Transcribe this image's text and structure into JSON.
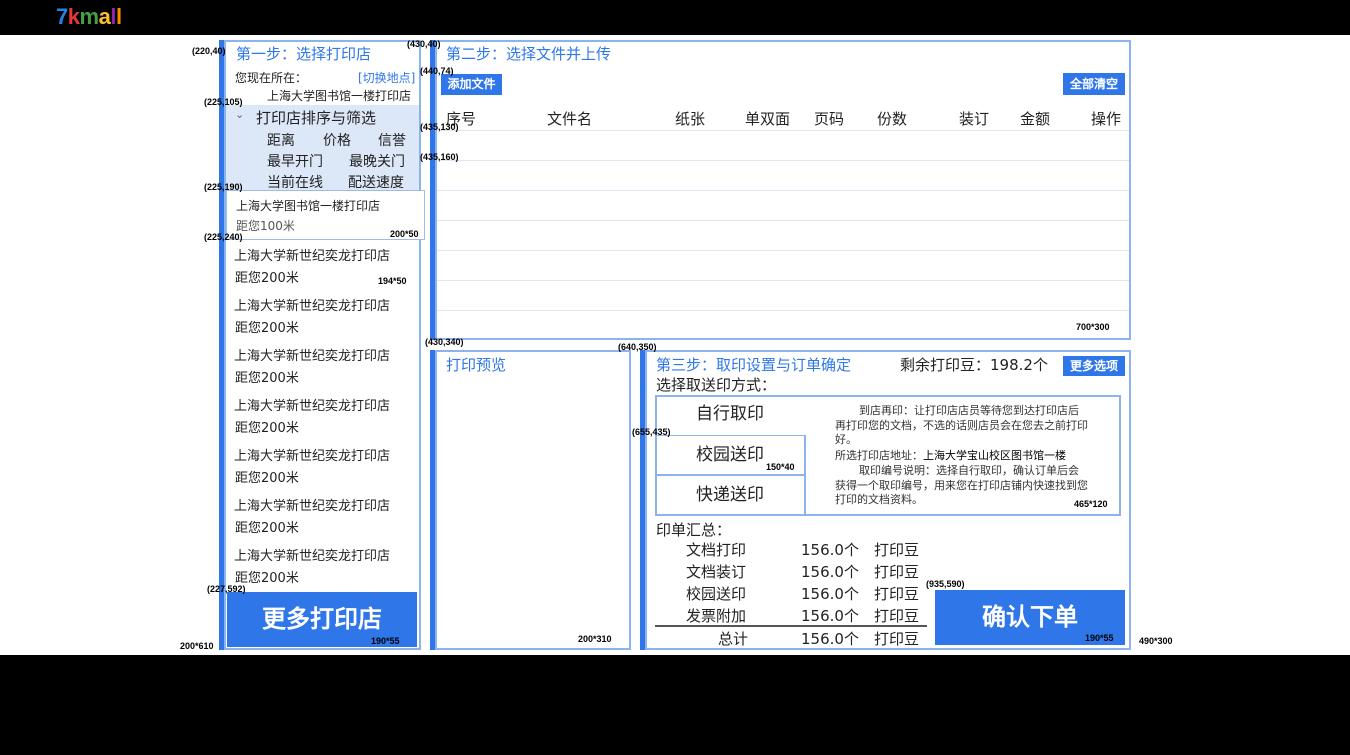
{
  "logo": {
    "parts": [
      {
        "t": "7",
        "c": "#1e88e5"
      },
      {
        "t": "k",
        "c": "#e53935"
      },
      {
        "t": "m",
        "c": "#43a047"
      },
      {
        "t": "a",
        "c": "#fbc02d"
      },
      {
        "t": "l",
        "c": "#8e24aa"
      },
      {
        "t": "l",
        "c": "#fb8c00"
      }
    ]
  },
  "annotations": {
    "a1": "(220,40)",
    "a2": "(430,40)",
    "a3": "(440,74)",
    "a4": "(225,105)",
    "a5": "(435,130)",
    "a6": "(435,160)",
    "a7": "(225,190)",
    "a8": "200*50",
    "a9": "(225,240)",
    "a10": "194*50",
    "a11": "(430,340)",
    "a12": "(640,350)",
    "a13": "(655,435)",
    "a14": "150*40",
    "a15": "465*120",
    "a16": "(227,592)",
    "a17": "(935,590)",
    "a18": "190*55",
    "a19": "200*610",
    "a20": "190*55",
    "a21": "200*310",
    "a22": "190*55",
    "a23": "490*300",
    "a24": "700*300"
  },
  "step1": {
    "title": "第一步：选择打印店",
    "location_label": "您现在所在：",
    "switch_link": "[切换地点]",
    "current_store": "上海大学图书馆一楼打印店",
    "sort_title": "打印店排序与筛选",
    "sort_options": [
      "距离",
      "价格",
      "信誉",
      "最早开门",
      "最晚关门",
      "当前在线",
      "配送速度"
    ],
    "selected_store": {
      "name": "上海大学图书馆一楼打印店",
      "distance": "距您100米"
    },
    "stores": [
      {
        "name": "上海大学新世纪奕龙打印店",
        "distance": "距您200米"
      },
      {
        "name": "上海大学新世纪奕龙打印店",
        "distance": "距您200米"
      },
      {
        "name": "上海大学新世纪奕龙打印店",
        "distance": "距您200米"
      },
      {
        "name": "上海大学新世纪奕龙打印店",
        "distance": "距您200米"
      },
      {
        "name": "上海大学新世纪奕龙打印店",
        "distance": "距您200米"
      },
      {
        "name": "上海大学新世纪奕龙打印店",
        "distance": "距您200米"
      },
      {
        "name": "上海大学新世纪奕龙打印店",
        "distance": "距您200米"
      }
    ],
    "more_button": "更多打印店"
  },
  "step2": {
    "title": "第二步：选择文件并上传",
    "add_button": "添加文件",
    "clear_button": "全部清空",
    "columns": [
      "序号",
      "文件名",
      "纸张",
      "单双面",
      "页码",
      "份数",
      "装订",
      "金额",
      "操作"
    ]
  },
  "preview": {
    "title": "打印预览"
  },
  "step3": {
    "title": "第三步：取印设置与订单确定",
    "beans_label": "剩余打印豆：198.2个",
    "more_options": "更多选项",
    "method_label": "选择取送印方式：",
    "methods": [
      "自行取印",
      "校园送印",
      "快递送印"
    ],
    "desc_line1": "到店再印：让打印店店员等待您到达打印店后再打印您的文档，不选的话则店员会在您去之前打印好。",
    "desc_addr_label": "所选打印店地址：",
    "desc_addr_value": "上海大学宝山校区图书馆一楼",
    "desc_line3": "取印编号说明：选择自行取印，确认订单后会获得一个取印编号，用来您在打印店铺内快速找到您打印的文档资料。",
    "summary_label": "印单汇总：",
    "summary": [
      {
        "item": "文档打印",
        "amount": "156.0个",
        "unit": "打印豆"
      },
      {
        "item": "文档装订",
        "amount": "156.0个",
        "unit": "打印豆"
      },
      {
        "item": "校园送印",
        "amount": "156.0个",
        "unit": "打印豆"
      },
      {
        "item": "发票附加",
        "amount": "156.0个",
        "unit": "打印豆"
      }
    ],
    "total": {
      "item": "总计",
      "amount": "156.0个",
      "unit": "打印豆"
    },
    "confirm_button": "确认下单"
  }
}
